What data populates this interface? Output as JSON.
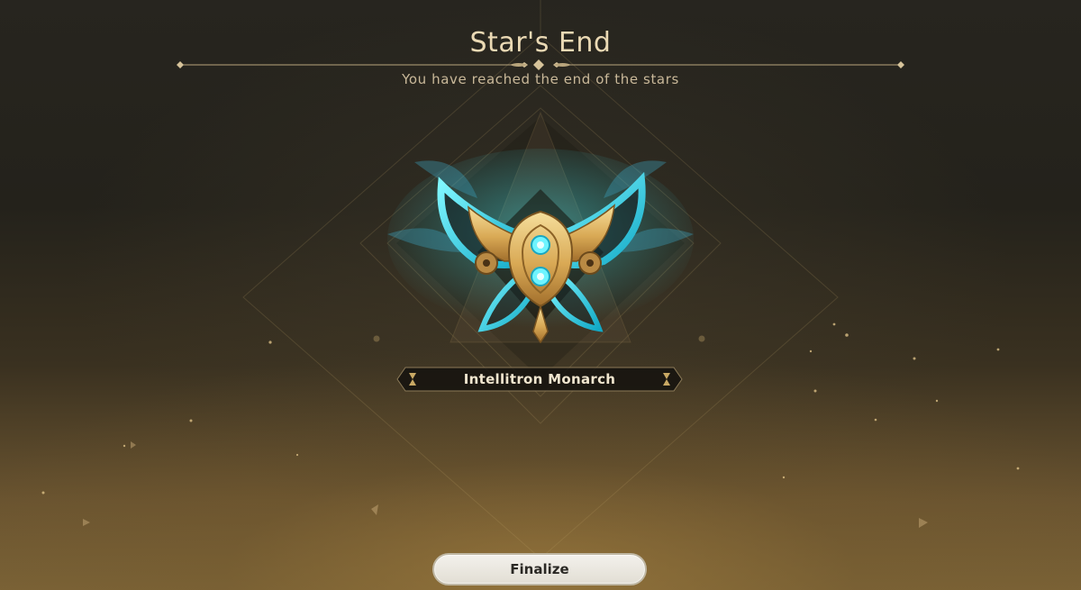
{
  "screen": {
    "title": "Star's End",
    "subtitle": "You have reached the end of the stars"
  },
  "reward": {
    "name": "Intellitron Monarch",
    "emblem_icon": "butterfly-emblem-icon"
  },
  "actions": {
    "finalize_label": "Finalize"
  },
  "colors": {
    "accent_gold": "#d8b878",
    "emblem_cyan": "#38e6f0",
    "button_face": "#efece5"
  }
}
